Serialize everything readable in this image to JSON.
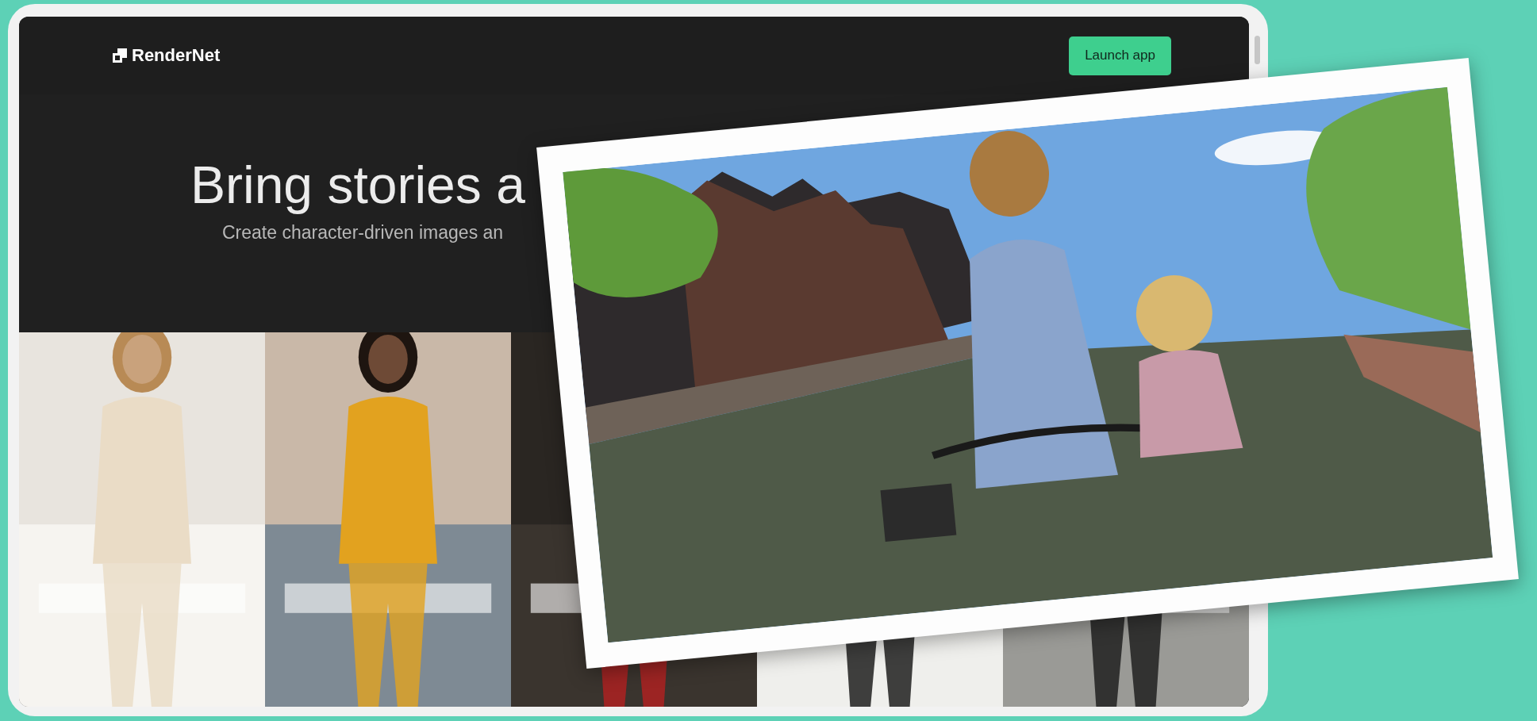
{
  "nav": {
    "logo": "RenderNet",
    "button": "Launch app"
  },
  "hero": {
    "title": "Bring stories a",
    "subtitle": "Create character-driven images an"
  }
}
